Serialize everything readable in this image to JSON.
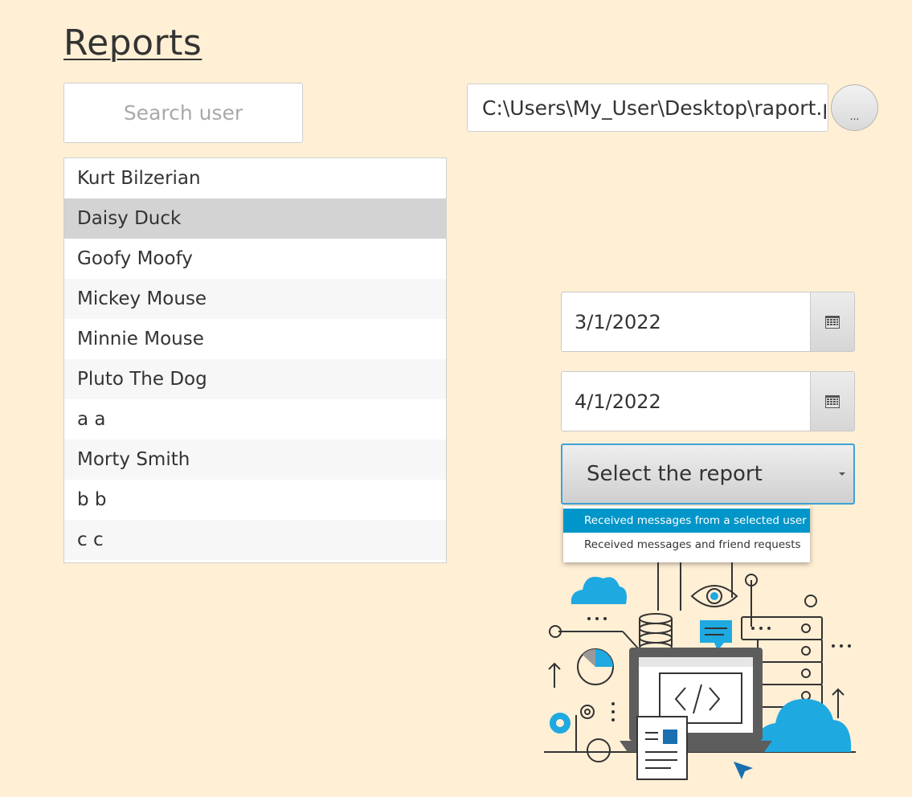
{
  "page": {
    "title": "Reports"
  },
  "search": {
    "placeholder": "Search user"
  },
  "users": {
    "items": [
      "Kurt Bilzerian",
      "Daisy Duck",
      "Goofy Moofy",
      "Mickey Mouse",
      "Minnie Mouse",
      "Pluto The Dog",
      "a a",
      "Morty Smith",
      "b b",
      "c c"
    ],
    "selected": "Daisy Duck"
  },
  "file": {
    "path": "C:\\Users\\My_User\\Desktop\\raport.pdf",
    "browse_label": "..."
  },
  "dates": {
    "from": "3/1/2022",
    "to": "4/1/2022"
  },
  "report_select": {
    "prompt": "Select the report",
    "options": [
      "Received messages from a selected user",
      "Received messages and friend requests"
    ],
    "highlighted": "Received messages from a selected user"
  },
  "colors": {
    "background": "#FFEFD5",
    "accent": "#0096C9",
    "selection": "#D3D3D3",
    "illustration_blue": "#1FA9E1"
  },
  "icons": [
    "calendar-icon",
    "chevron-down-icon",
    "tech-illustration"
  ]
}
